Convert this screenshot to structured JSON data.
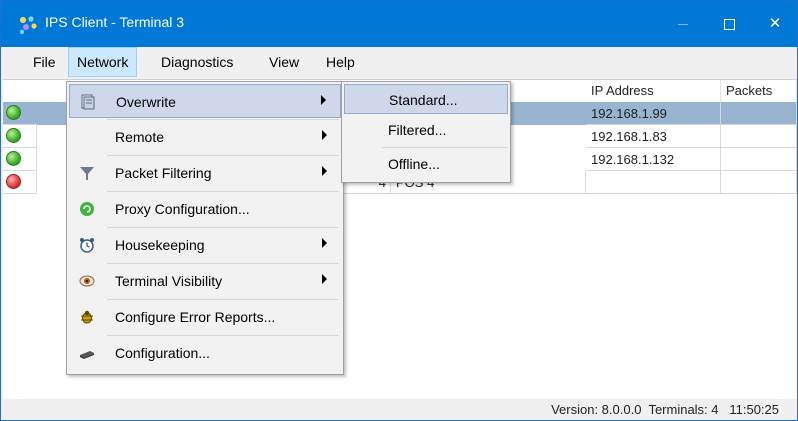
{
  "window": {
    "title": "IPS Client - Terminal 3",
    "app_icon": "ips-logo-icon",
    "controls": {
      "minimize": "minimize-icon",
      "maximize": "maximize-icon",
      "close_label": "✕"
    }
  },
  "menubar": {
    "items": [
      {
        "label": "File"
      },
      {
        "label": "Network",
        "active": true
      },
      {
        "label": "Diagnostics"
      },
      {
        "label": "View"
      },
      {
        "label": "Help"
      }
    ]
  },
  "grid": {
    "columns": {
      "ip": "IP Address",
      "packets": "Packets"
    },
    "rows": [
      {
        "status": "green",
        "id": "",
        "name": "",
        "ip": "192.168.1.99",
        "packets": "",
        "selected": true
      },
      {
        "status": "green",
        "id": "",
        "name": "",
        "ip": "192.168.1.83",
        "packets": ""
      },
      {
        "status": "green",
        "id": "",
        "name": "",
        "ip": "192.168.1.132",
        "packets": ""
      },
      {
        "status": "red",
        "id": "4",
        "name": "POS 4",
        "ip": "",
        "packets": ""
      }
    ]
  },
  "network_menu": {
    "items": [
      {
        "label": "Overwrite",
        "icon": "overwrite-icon",
        "submenu": true,
        "active": true
      },
      {
        "label": "Remote",
        "icon": "",
        "submenu": true
      },
      {
        "label": "Packet Filtering",
        "icon": "packet-filter-icon",
        "submenu": true
      },
      {
        "label": "Proxy Configuration...",
        "icon": "proxy-icon",
        "submenu": false
      },
      {
        "label": "Housekeeping",
        "icon": "alarm-clock-icon",
        "submenu": true
      },
      {
        "label": "Terminal Visibility",
        "icon": "eye-icon",
        "submenu": true
      },
      {
        "label": "Configure Error Reports...",
        "icon": "bug-icon",
        "submenu": false
      },
      {
        "label": "Configuration...",
        "icon": "device-icon",
        "submenu": false
      }
    ]
  },
  "overwrite_submenu": {
    "items": [
      {
        "label": "Standard...",
        "active": true
      },
      {
        "label": "Filtered..."
      },
      {
        "label": "Offline..."
      }
    ]
  },
  "statusbar": {
    "version": "Version: 8.0.0.0",
    "terminals": "Terminals: 4",
    "time": "11:50:25"
  },
  "colors": {
    "titlebar": "#0078d7",
    "selection": "#99b4d1",
    "menu_highlight": "#cfd8ea",
    "status_ok": "#3fae2a",
    "status_error": "#d9383a"
  }
}
